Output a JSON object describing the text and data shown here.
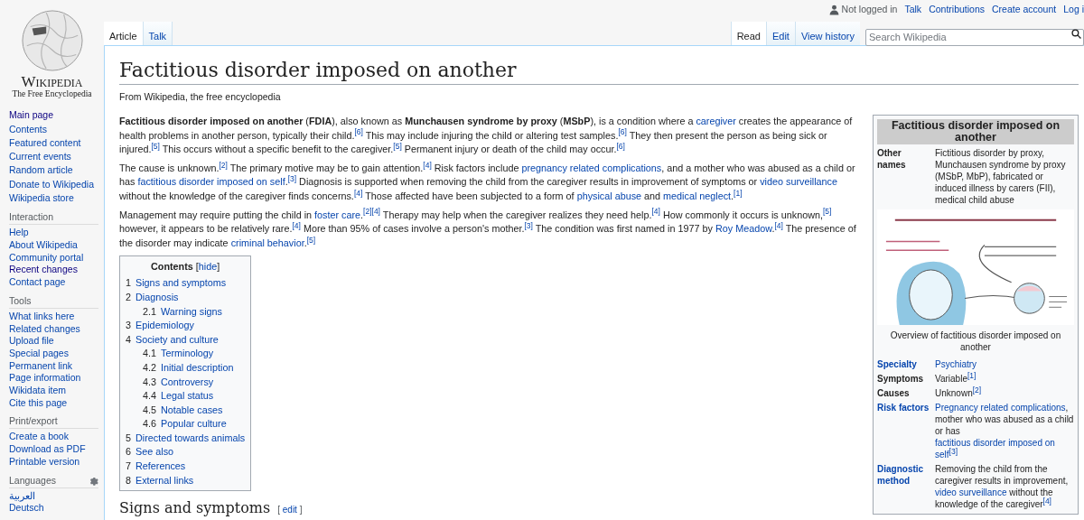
{
  "logo": {
    "wordmark": "Wikipedia",
    "tagline": "The Free Encyclopedia"
  },
  "personal_bar": {
    "status": "Not logged in",
    "links": [
      "Talk",
      "Contributions",
      "Create account",
      "Log i"
    ]
  },
  "tabs_left": [
    {
      "label": "Article",
      "selected": true
    },
    {
      "label": "Talk",
      "selected": false
    }
  ],
  "tabs_right": [
    {
      "label": "Read",
      "selected": true
    },
    {
      "label": "Edit",
      "selected": false
    },
    {
      "label": "View history",
      "selected": false
    }
  ],
  "search": {
    "placeholder": "Search Wikipedia"
  },
  "sidebar": {
    "sections": [
      {
        "settings_button": false,
        "items": [
          {
            "label": "Main page",
            "visited": true
          },
          {
            "label": "Contents",
            "visited": false
          },
          {
            "label": "Featured content",
            "visited": false
          },
          {
            "label": "Current events",
            "visited": false
          },
          {
            "label": "Random article",
            "visited": false
          },
          {
            "label": "Donate to Wikipedia",
            "visited": false
          },
          {
            "label": "Wikipedia store",
            "visited": false
          }
        ]
      },
      {
        "heading": "Interaction",
        "settings_button": false,
        "items": [
          {
            "label": "Help",
            "visited": false
          },
          {
            "label": "About Wikipedia",
            "visited": false
          },
          {
            "label": "Community portal",
            "visited": false
          },
          {
            "label": "Recent changes",
            "visited": true
          },
          {
            "label": "Contact page",
            "visited": false
          }
        ]
      },
      {
        "heading": "Tools",
        "settings_button": false,
        "items": [
          {
            "label": "What links here",
            "visited": false
          },
          {
            "label": "Related changes",
            "visited": false
          },
          {
            "label": "Upload file",
            "visited": false
          },
          {
            "label": "Special pages",
            "visited": false
          },
          {
            "label": "Permanent link",
            "visited": false
          },
          {
            "label": "Page information",
            "visited": false
          },
          {
            "label": "Wikidata item",
            "visited": false
          },
          {
            "label": "Cite this page",
            "visited": false
          }
        ]
      },
      {
        "heading": "Print/export",
        "settings_button": false,
        "items": [
          {
            "label": "Create a book",
            "visited": false
          },
          {
            "label": "Download as PDF",
            "visited": false
          },
          {
            "label": "Printable version",
            "visited": false
          }
        ]
      },
      {
        "heading": "Languages",
        "settings_button": true,
        "items": [
          {
            "label": "العربية",
            "visited": false
          },
          {
            "label": "Deutsch",
            "visited": false
          }
        ]
      }
    ]
  },
  "article": {
    "title": "Factitious disorder imposed on another",
    "subtitle": "From Wikipedia, the free encyclopedia",
    "paragraphs": [
      [
        {
          "kind": "bold",
          "text": "Factitious disorder imposed on another"
        },
        {
          "kind": "text",
          "text": " ("
        },
        {
          "kind": "bold",
          "text": "FDIA"
        },
        {
          "kind": "text",
          "text": "), also known as "
        },
        {
          "kind": "bold",
          "text": "Munchausen syndrome by proxy"
        },
        {
          "kind": "text",
          "text": " ("
        },
        {
          "kind": "bold",
          "text": "MSbP"
        },
        {
          "kind": "text",
          "text": "), is a condition where a "
        },
        {
          "kind": "link",
          "text": "caregiver"
        },
        {
          "kind": "text",
          "text": " creates the appearance of health problems in another person, typically their child."
        },
        {
          "kind": "ref",
          "text": "[6]"
        },
        {
          "kind": "text",
          "text": " This may include injuring the child or altering test samples."
        },
        {
          "kind": "ref",
          "text": "[6]"
        },
        {
          "kind": "text",
          "text": " They then present the person as being sick or injured."
        },
        {
          "kind": "ref",
          "text": "[5]"
        },
        {
          "kind": "text",
          "text": " This occurs without a specific benefit to the caregiver."
        },
        {
          "kind": "ref",
          "text": "[5]"
        },
        {
          "kind": "text",
          "text": " Permanent injury or death of the child may occur."
        },
        {
          "kind": "ref",
          "text": "[6]"
        }
      ],
      [
        {
          "kind": "text",
          "text": "The cause is unknown."
        },
        {
          "kind": "ref",
          "text": "[2]"
        },
        {
          "kind": "text",
          "text": " The primary motive may be to gain attention."
        },
        {
          "kind": "ref",
          "text": "[4]"
        },
        {
          "kind": "text",
          "text": " Risk factors include "
        },
        {
          "kind": "link",
          "text": "pregnancy related complications"
        },
        {
          "kind": "text",
          "text": ", and a mother who was abused as a child or has "
        },
        {
          "kind": "link",
          "text": "factitious disorder imposed on self"
        },
        {
          "kind": "text",
          "text": "."
        },
        {
          "kind": "ref",
          "text": "[3]"
        },
        {
          "kind": "text",
          "text": " Diagnosis is supported when removing the child from the caregiver results in improvement of symptoms or "
        },
        {
          "kind": "link",
          "text": "video surveillance"
        },
        {
          "kind": "text",
          "text": " without the knowledge of the caregiver finds concerns."
        },
        {
          "kind": "ref",
          "text": "[4]"
        },
        {
          "kind": "text",
          "text": " Those affected have been subjected to a form of "
        },
        {
          "kind": "link",
          "text": "physical abuse"
        },
        {
          "kind": "text",
          "text": " and "
        },
        {
          "kind": "link",
          "text": "medical neglect"
        },
        {
          "kind": "text",
          "text": "."
        },
        {
          "kind": "ref",
          "text": "[1]"
        }
      ],
      [
        {
          "kind": "text",
          "text": "Management may require putting the child in "
        },
        {
          "kind": "link",
          "text": "foster care"
        },
        {
          "kind": "text",
          "text": "."
        },
        {
          "kind": "ref",
          "text": "[2]"
        },
        {
          "kind": "ref",
          "text": "[4]"
        },
        {
          "kind": "text",
          "text": " Therapy may help when the caregiver realizes they need help."
        },
        {
          "kind": "ref",
          "text": "[4]"
        },
        {
          "kind": "text",
          "text": " How commonly it occurs is unknown,"
        },
        {
          "kind": "ref",
          "text": "[5]"
        },
        {
          "kind": "text",
          "text": " however, it appears to be relatively rare."
        },
        {
          "kind": "ref",
          "text": "[4]"
        },
        {
          "kind": "text",
          "text": " More than 95% of cases involve a person's mother."
        },
        {
          "kind": "ref",
          "text": "[3]"
        },
        {
          "kind": "text",
          "text": " The condition was first named in 1977 by "
        },
        {
          "kind": "link",
          "text": "Roy Meadow"
        },
        {
          "kind": "text",
          "text": "."
        },
        {
          "kind": "ref",
          "text": "[4]"
        },
        {
          "kind": "text",
          "text": " The presence of the disorder may indicate "
        },
        {
          "kind": "link",
          "text": "criminal behavior"
        },
        {
          "kind": "text",
          "text": "."
        },
        {
          "kind": "ref",
          "text": "[5]"
        }
      ]
    ],
    "toc": {
      "title": "Contents",
      "toggle": "[hide]",
      "items": [
        {
          "number": "1",
          "label": "Signs and symptoms"
        },
        {
          "number": "2",
          "label": "Diagnosis",
          "children": [
            {
              "number": "2.1",
              "label": "Warning signs"
            }
          ]
        },
        {
          "number": "3",
          "label": "Epidemiology"
        },
        {
          "number": "4",
          "label": "Society and culture",
          "children": [
            {
              "number": "4.1",
              "label": "Terminology"
            },
            {
              "number": "4.2",
              "label": "Initial description"
            },
            {
              "number": "4.3",
              "label": "Controversy"
            },
            {
              "number": "4.4",
              "label": "Legal status"
            },
            {
              "number": "4.5",
              "label": "Notable cases"
            },
            {
              "number": "4.6",
              "label": "Popular culture"
            }
          ]
        },
        {
          "number": "5",
          "label": "Directed towards animals"
        },
        {
          "number": "6",
          "label": "See also"
        },
        {
          "number": "7",
          "label": "References"
        },
        {
          "number": "8",
          "label": "External links"
        }
      ]
    },
    "section_heading": {
      "title": "Signs and symptoms",
      "edit": "[ edit ]"
    }
  },
  "infobox": {
    "title": "Factitious disorder imposed on another",
    "rows": [
      {
        "kind": "row",
        "label": "Other names",
        "label_link": false,
        "value": [
          {
            "kind": "text",
            "text": "Fictitious disorder by proxy, Munchausen syndrome by proxy (MSbP, MbP), fabricated or induced illness by carers (FII), medical child abuse"
          }
        ]
      },
      {
        "caption": "Overview of factitious disorder imposed on another"
      },
      {
        "kind": "row",
        "label": "Specialty",
        "label_link": true,
        "value": [
          {
            "kind": "link",
            "text": "Psychiatry"
          }
        ]
      },
      {
        "kind": "row",
        "label": "Symptoms",
        "label_link": false,
        "value": [
          {
            "kind": "text",
            "text": "Variable"
          },
          {
            "kind": "ref",
            "text": "[1]"
          }
        ]
      },
      {
        "kind": "row",
        "label": "Causes",
        "label_link": false,
        "value": [
          {
            "kind": "text",
            "text": "Unknown"
          },
          {
            "kind": "ref",
            "text": "[2]"
          }
        ]
      },
      {
        "kind": "row",
        "label": "Risk factors",
        "label_link": true,
        "value": [
          {
            "kind": "link",
            "text": "Pregnancy related"
          },
          {
            "kind": "link",
            "text": "complications"
          },
          {
            "kind": "text",
            "text": ", mother who was abused as a child or has "
          },
          {
            "kind": "link",
            "text": "factitious disorder imposed on"
          },
          {
            "kind": "link",
            "text": "self"
          },
          {
            "kind": "ref",
            "text": "[3]"
          }
        ]
      },
      {
        "kind": "row",
        "label": "Diagnostic method",
        "label_link": true,
        "value": [
          {
            "kind": "text",
            "text": "Removing the child from the caregiver results in improvement, "
          },
          {
            "kind": "link",
            "text": "video surveillance"
          },
          {
            "kind": "text",
            "text": " without the knowledge of the caregiver"
          },
          {
            "kind": "ref",
            "text": "[4]"
          }
        ]
      }
    ]
  }
}
